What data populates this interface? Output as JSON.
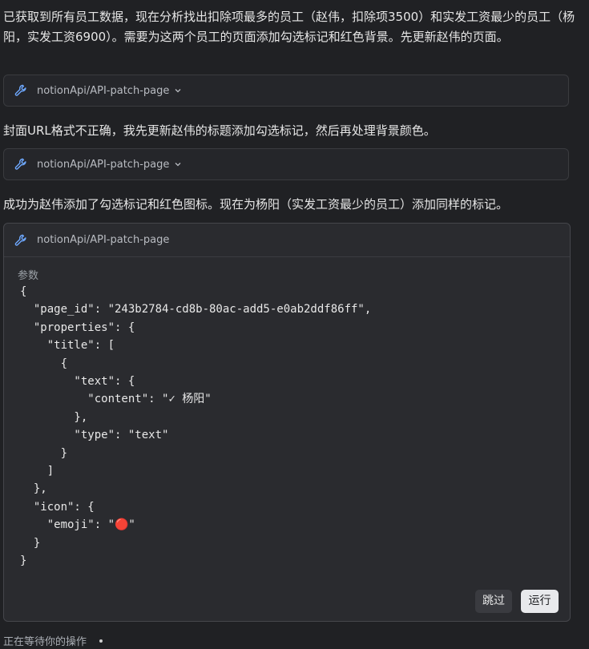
{
  "messages": [
    "已获取到所有员工数据，现在分析找出扣除项最多的员工（赵伟，扣除项3500）和实发工资最少的员工（杨阳，实发工资6900）。需要为这两个员工的页面添加勾选标记和红色背景。先更新赵伟的页面。",
    "封面URL格式不正确，我先更新赵伟的标题添加勾选标记，然后再处理背景颜色。",
    "成功为赵伟添加了勾选标记和红色图标。现在为杨阳（实发工资最少的员工）添加同样的标记。"
  ],
  "tool_calls": [
    {
      "name": "notionApi/API-patch-page",
      "icon": "wrench-icon",
      "state": "collapsed"
    },
    {
      "name": "notionApi/API-patch-page",
      "icon": "wrench-icon",
      "state": "collapsed"
    },
    {
      "name": "notionApi/API-patch-page",
      "icon": "wrench-icon",
      "state": "expanded"
    }
  ],
  "params_label": "参数",
  "params_code": "{\n  \"page_id\": \"243b2784-cd8b-80ac-add5-e0ab2ddf86ff\",\n  \"properties\": {\n    \"title\": [\n      {\n        \"text\": {\n          \"content\": \"✓ 杨阳\"\n        },\n        \"type\": \"text\"\n      }\n    ]\n  },\n  \"icon\": {\n    \"emoji\": \"🔴\"\n  }\n}",
  "buttons": {
    "skip": "跳过",
    "run": "运行"
  },
  "status": "正在等待你的操作",
  "colors": {
    "background": "#202124",
    "accent_icon": "#6ea8fe",
    "run_button": "#e8e9ec"
  }
}
